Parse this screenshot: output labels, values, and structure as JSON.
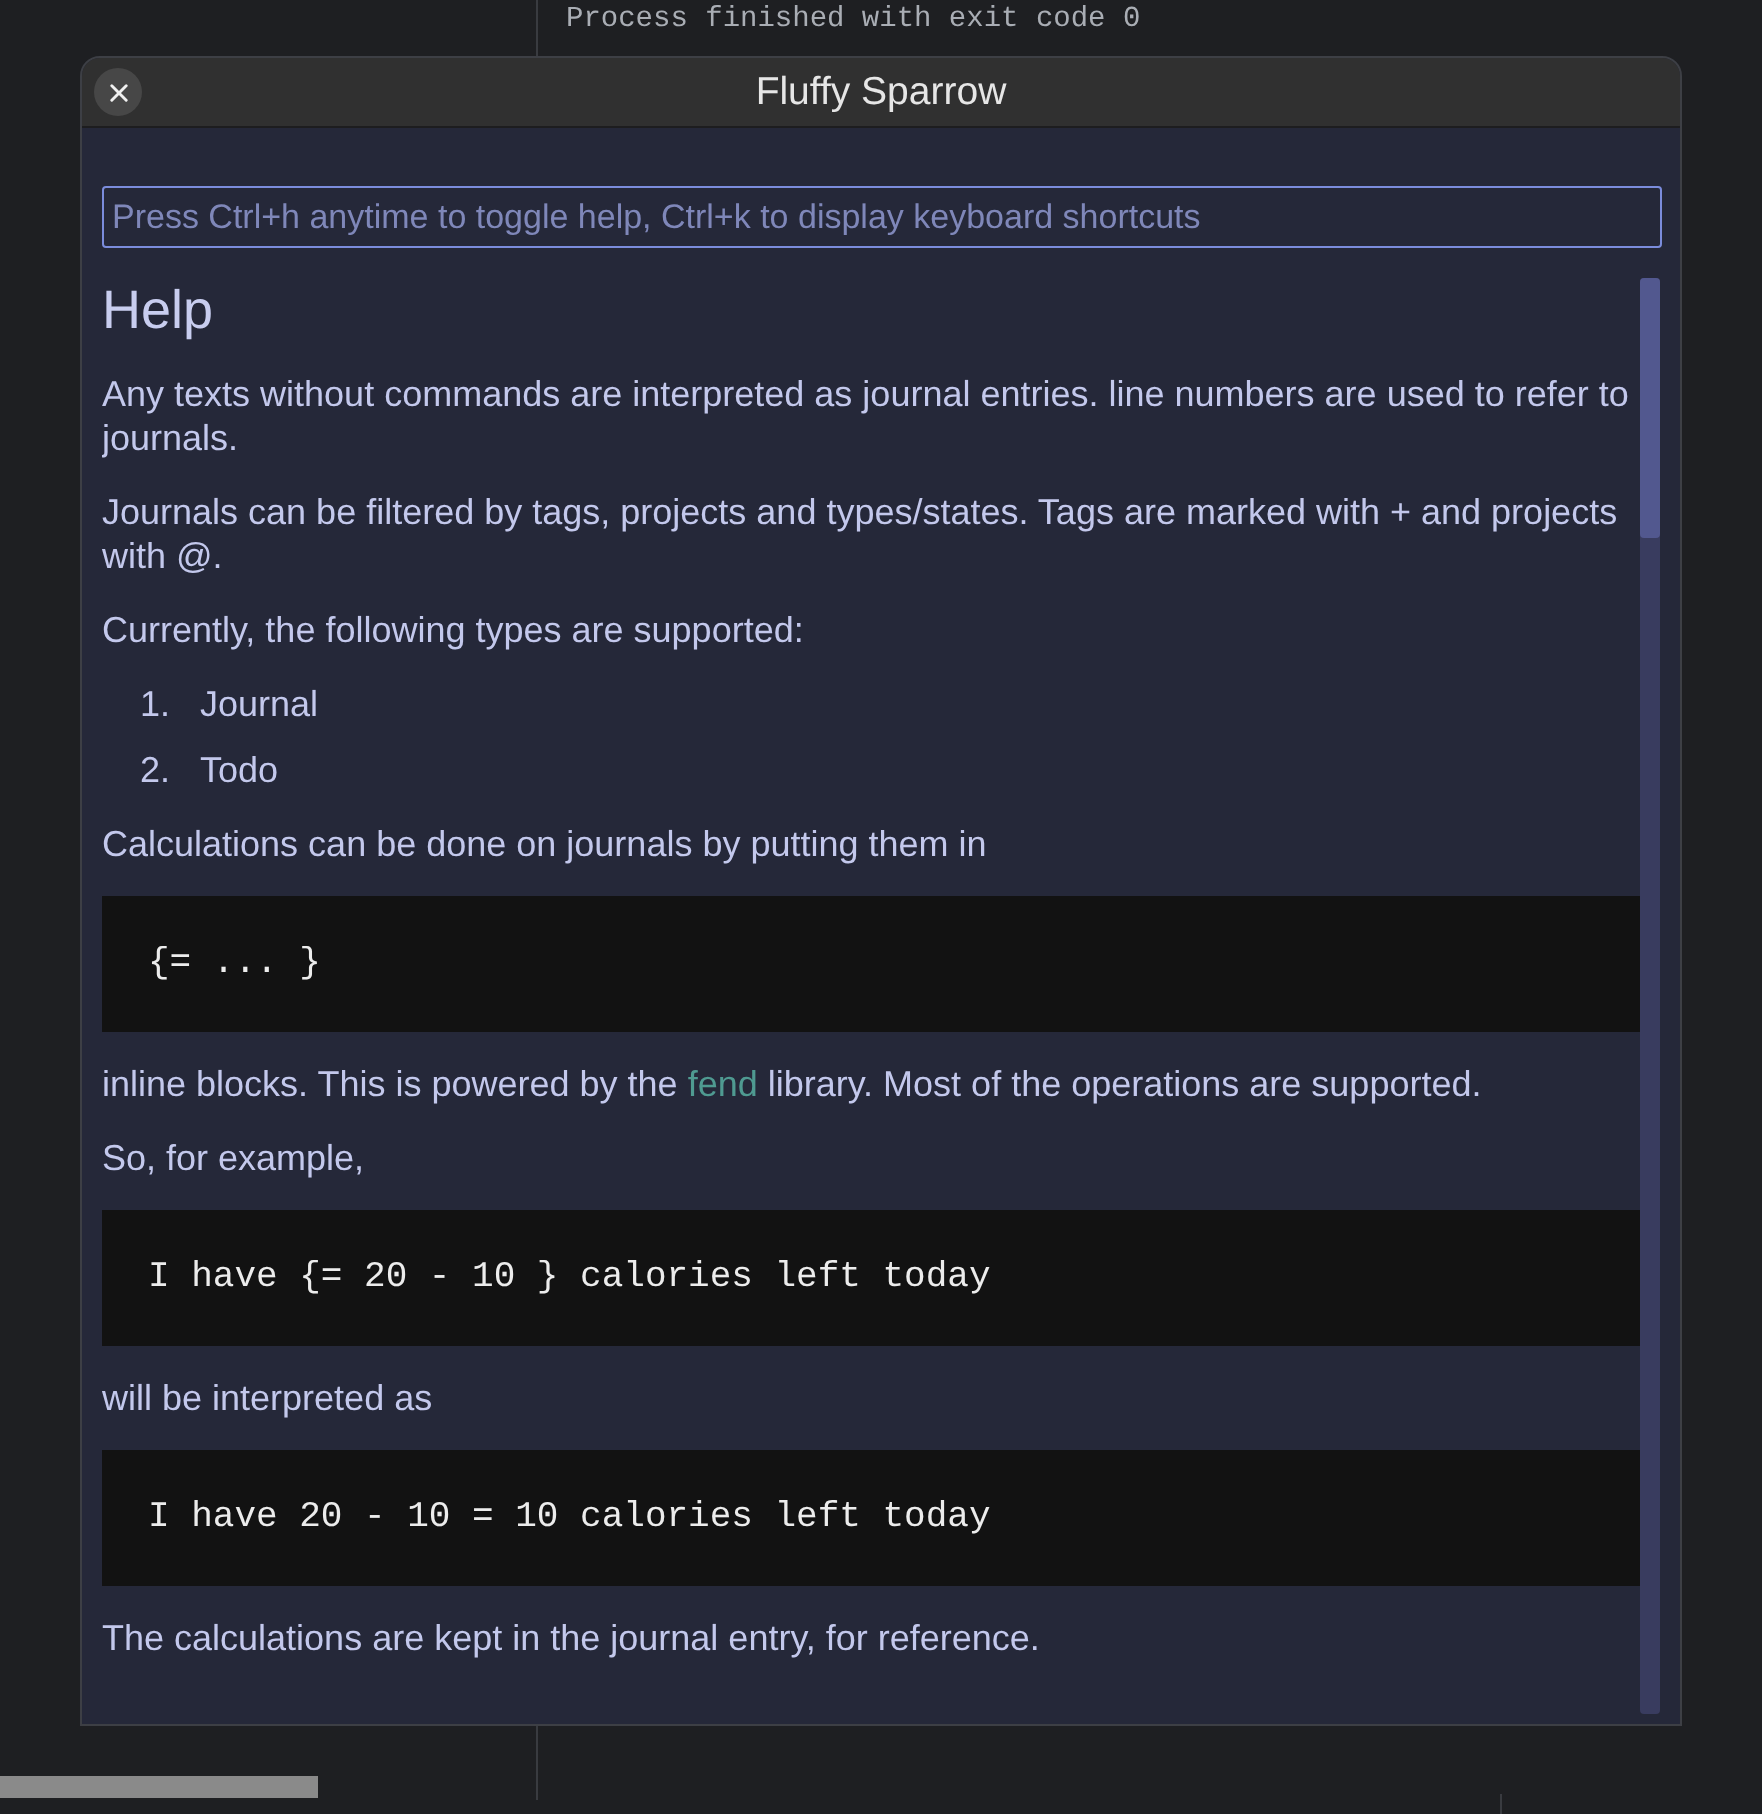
{
  "console": {
    "output": "Process finished with exit code 0"
  },
  "window": {
    "title": "Fluffy Sparrow"
  },
  "command_input": {
    "placeholder": "Press Ctrl+h anytime to toggle help, Ctrl+k to display keyboard shortcuts"
  },
  "help": {
    "blocks": [
      {
        "kind": "heading",
        "text": "Help"
      },
      {
        "kind": "paragraph",
        "text": "Any texts without commands are interpreted as journal entries. line numbers are used to refer to journals."
      },
      {
        "kind": "paragraph",
        "text": "Journals can be filtered by tags, projects and types/states. Tags are marked with + and projects with @."
      },
      {
        "kind": "paragraph",
        "text": "Currently, the following types are supported:"
      },
      {
        "kind": "list",
        "items": [
          {
            "number": "1.",
            "text": "Journal"
          },
          {
            "number": "2.",
            "text": "Todo"
          }
        ]
      },
      {
        "kind": "paragraph",
        "text": "Calculations can be done on journals by putting them in"
      },
      {
        "kind": "code",
        "text": "{= ... }"
      },
      {
        "kind": "paragraph",
        "parts": [
          {
            "kind": "text",
            "text": "inline blocks. This is powered by the "
          },
          {
            "kind": "link",
            "text": "fend"
          },
          {
            "kind": "text",
            "text": " library. Most of the operations are supported."
          }
        ]
      },
      {
        "kind": "paragraph",
        "text": "So, for example,"
      },
      {
        "kind": "code",
        "text": "I have {= 20 - 10 } calories left today"
      },
      {
        "kind": "paragraph",
        "text": "will be interpreted as"
      },
      {
        "kind": "code",
        "text": "I have 20 - 10 = 10 calories left today"
      },
      {
        "kind": "paragraph",
        "text": "The calculations are kept in the journal entry, for reference."
      }
    ]
  }
}
